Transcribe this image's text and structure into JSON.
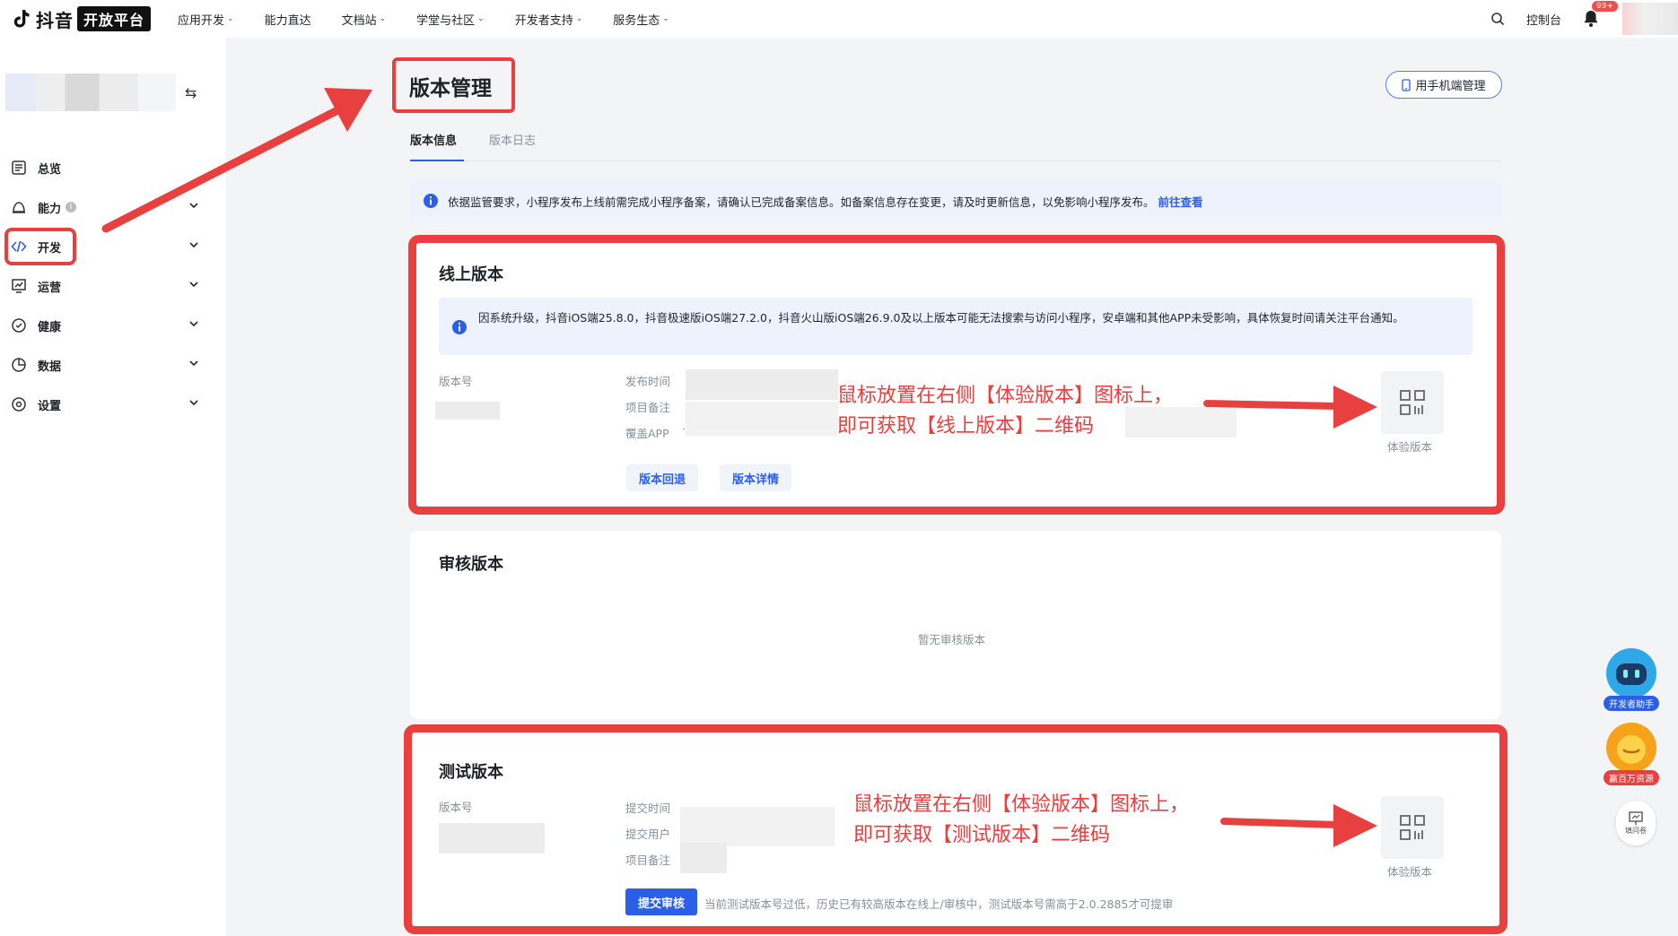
{
  "nav": {
    "brand": "抖音",
    "brand_badge": "开放平台",
    "items": [
      {
        "label": "应用开发",
        "caret": "⌄"
      },
      {
        "label": "能力直达",
        "caret": ""
      },
      {
        "label": "文档站",
        "caret": "⌄"
      },
      {
        "label": "学堂与社区",
        "caret": "⌄"
      },
      {
        "label": "开发者支持",
        "caret": "⌄"
      },
      {
        "label": "服务生态",
        "caret": "⌄"
      }
    ],
    "console": "控制台",
    "notification_count": "99+",
    "icons": {
      "search": "search-icon",
      "bell": "bell-icon"
    }
  },
  "sidebar": {
    "switch_icon": "⇆",
    "items": [
      {
        "label": "总览",
        "icon": "overview-icon"
      },
      {
        "label": "能力",
        "icon": "ability-icon",
        "info": "i"
      },
      {
        "label": "开发",
        "icon": "code-icon"
      },
      {
        "label": "运营",
        "icon": "operation-icon"
      },
      {
        "label": "健康",
        "icon": "health-icon"
      },
      {
        "label": "数据",
        "icon": "data-icon"
      },
      {
        "label": "设置",
        "icon": "settings-icon"
      }
    ]
  },
  "page": {
    "title": "版本管理",
    "mobile_manage": "用手机端管理",
    "tabs": [
      "版本信息",
      "版本日志"
    ],
    "notice": "依据监管要求，小程序发布上线前需完成小程序备案，请确认已完成备案信息。如备案信息存在变更，请及时更新信息，以免影响小程序发布。",
    "notice_link": "前往查看"
  },
  "online": {
    "title": "线上版本",
    "warning": "因系统升级，抖音iOS端25.8.0，抖音极速版iOS端27.2.0，抖音火山版iOS端26.9.0及以上版本可能无法搜索与访问小程序，安卓端和其他APP未受影响，具体恢复时间请关注平台通知。",
    "version_label": "版本号",
    "publish_time_label": "发布时间",
    "remark_label": "项目备注",
    "cover_app_label": "覆盖APP",
    "cover_app_sep": "·",
    "rollback_button": "版本回退",
    "detail_button": "版本详情",
    "qr_caption": "体验版本",
    "annotation_line1": "鼠标放置在右侧【体验版本】图标上，",
    "annotation_line2": "即可获取【线上版本】二维码"
  },
  "review": {
    "title": "审核版本",
    "empty": "暂无审核版本"
  },
  "test": {
    "title": "测试版本",
    "version_label": "版本号",
    "submit_time_label": "提交时间",
    "submit_user_label": "提交用户",
    "remark_label": "项目备注",
    "submit_button": "提交审核",
    "submit_hint": "当前测试版本号过低，历史已有较高版本在线上/审核中，测试版本号需高于2.0.2885才可提审",
    "qr_caption": "体验版本",
    "annotation_line1": "鼠标放置在右侧【体验版本】图标上，",
    "annotation_line2": "即可获取【测试版本】二维码"
  },
  "floating": {
    "assistant": "开发者助手",
    "resources": "赢百万资源",
    "survey": "填问卷"
  },
  "colors": {
    "accent": "#2b5fe8",
    "annotation_red": "#e8403f",
    "notice_bg": "#edf2fd",
    "page_bg": "#f3f4f6"
  }
}
